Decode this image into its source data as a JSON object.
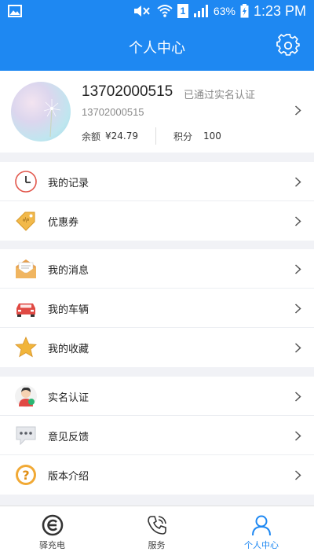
{
  "status_bar": {
    "battery_percent": "63%",
    "time": "1:23 PM",
    "sim_label": "1"
  },
  "header": {
    "title": "个人中心"
  },
  "profile": {
    "phone": "13702000515",
    "verified_text": "已通过实名认证",
    "phone_sub": "13702000515",
    "balance_label": "余额",
    "balance_value": "¥24.79",
    "points_label": "积分",
    "points_value": "100"
  },
  "menu_groups": [
    {
      "items": [
        {
          "label": "我的记录",
          "icon": "clock-icon"
        },
        {
          "label": "优惠券",
          "icon": "coupon-tag-icon"
        }
      ]
    },
    {
      "items": [
        {
          "label": "我的消息",
          "icon": "envelope-icon"
        },
        {
          "label": "我的车辆",
          "icon": "car-icon"
        },
        {
          "label": "我的收藏",
          "icon": "star-icon"
        }
      ]
    },
    {
      "items": [
        {
          "label": "实名认证",
          "icon": "user-avatar-icon"
        },
        {
          "label": "意见反馈",
          "icon": "chat-bubble-icon"
        },
        {
          "label": "版本介绍",
          "icon": "question-icon"
        }
      ]
    }
  ],
  "bottom_nav": {
    "tabs": [
      {
        "label": "驿充电",
        "icon": "charge-logo-icon",
        "active": false
      },
      {
        "label": "服务",
        "icon": "phone-service-icon",
        "active": false
      },
      {
        "label": "个人中心",
        "icon": "person-icon",
        "active": true
      }
    ]
  },
  "colors": {
    "primary": "#1e88f2",
    "background": "#f1f2f6"
  }
}
